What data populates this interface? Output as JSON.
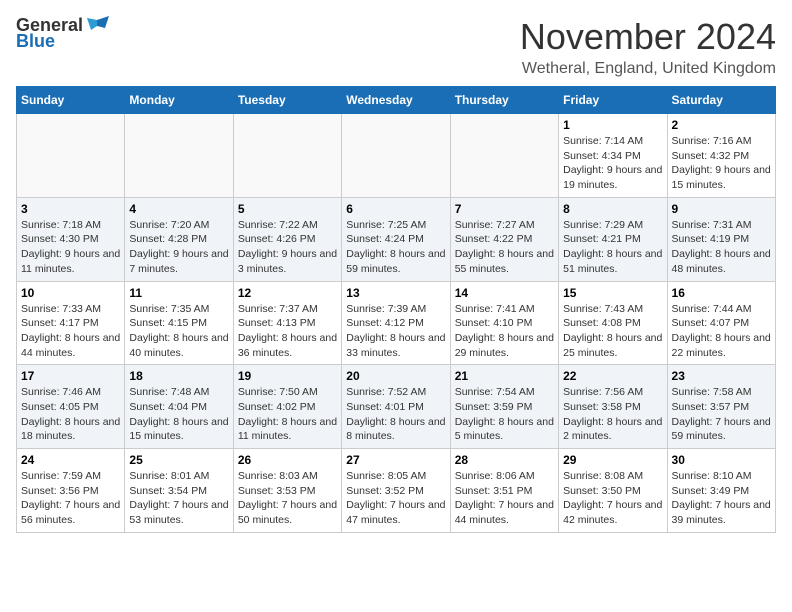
{
  "header": {
    "logo_general": "General",
    "logo_blue": "Blue",
    "month_title": "November 2024",
    "location": "Wetheral, England, United Kingdom"
  },
  "days_of_week": [
    "Sunday",
    "Monday",
    "Tuesday",
    "Wednesday",
    "Thursday",
    "Friday",
    "Saturday"
  ],
  "weeks": [
    [
      {
        "day": "",
        "info": ""
      },
      {
        "day": "",
        "info": ""
      },
      {
        "day": "",
        "info": ""
      },
      {
        "day": "",
        "info": ""
      },
      {
        "day": "",
        "info": ""
      },
      {
        "day": "1",
        "info": "Sunrise: 7:14 AM\nSunset: 4:34 PM\nDaylight: 9 hours and 19 minutes."
      },
      {
        "day": "2",
        "info": "Sunrise: 7:16 AM\nSunset: 4:32 PM\nDaylight: 9 hours and 15 minutes."
      }
    ],
    [
      {
        "day": "3",
        "info": "Sunrise: 7:18 AM\nSunset: 4:30 PM\nDaylight: 9 hours and 11 minutes."
      },
      {
        "day": "4",
        "info": "Sunrise: 7:20 AM\nSunset: 4:28 PM\nDaylight: 9 hours and 7 minutes."
      },
      {
        "day": "5",
        "info": "Sunrise: 7:22 AM\nSunset: 4:26 PM\nDaylight: 9 hours and 3 minutes."
      },
      {
        "day": "6",
        "info": "Sunrise: 7:25 AM\nSunset: 4:24 PM\nDaylight: 8 hours and 59 minutes."
      },
      {
        "day": "7",
        "info": "Sunrise: 7:27 AM\nSunset: 4:22 PM\nDaylight: 8 hours and 55 minutes."
      },
      {
        "day": "8",
        "info": "Sunrise: 7:29 AM\nSunset: 4:21 PM\nDaylight: 8 hours and 51 minutes."
      },
      {
        "day": "9",
        "info": "Sunrise: 7:31 AM\nSunset: 4:19 PM\nDaylight: 8 hours and 48 minutes."
      }
    ],
    [
      {
        "day": "10",
        "info": "Sunrise: 7:33 AM\nSunset: 4:17 PM\nDaylight: 8 hours and 44 minutes."
      },
      {
        "day": "11",
        "info": "Sunrise: 7:35 AM\nSunset: 4:15 PM\nDaylight: 8 hours and 40 minutes."
      },
      {
        "day": "12",
        "info": "Sunrise: 7:37 AM\nSunset: 4:13 PM\nDaylight: 8 hours and 36 minutes."
      },
      {
        "day": "13",
        "info": "Sunrise: 7:39 AM\nSunset: 4:12 PM\nDaylight: 8 hours and 33 minutes."
      },
      {
        "day": "14",
        "info": "Sunrise: 7:41 AM\nSunset: 4:10 PM\nDaylight: 8 hours and 29 minutes."
      },
      {
        "day": "15",
        "info": "Sunrise: 7:43 AM\nSunset: 4:08 PM\nDaylight: 8 hours and 25 minutes."
      },
      {
        "day": "16",
        "info": "Sunrise: 7:44 AM\nSunset: 4:07 PM\nDaylight: 8 hours and 22 minutes."
      }
    ],
    [
      {
        "day": "17",
        "info": "Sunrise: 7:46 AM\nSunset: 4:05 PM\nDaylight: 8 hours and 18 minutes."
      },
      {
        "day": "18",
        "info": "Sunrise: 7:48 AM\nSunset: 4:04 PM\nDaylight: 8 hours and 15 minutes."
      },
      {
        "day": "19",
        "info": "Sunrise: 7:50 AM\nSunset: 4:02 PM\nDaylight: 8 hours and 11 minutes."
      },
      {
        "day": "20",
        "info": "Sunrise: 7:52 AM\nSunset: 4:01 PM\nDaylight: 8 hours and 8 minutes."
      },
      {
        "day": "21",
        "info": "Sunrise: 7:54 AM\nSunset: 3:59 PM\nDaylight: 8 hours and 5 minutes."
      },
      {
        "day": "22",
        "info": "Sunrise: 7:56 AM\nSunset: 3:58 PM\nDaylight: 8 hours and 2 minutes."
      },
      {
        "day": "23",
        "info": "Sunrise: 7:58 AM\nSunset: 3:57 PM\nDaylight: 7 hours and 59 minutes."
      }
    ],
    [
      {
        "day": "24",
        "info": "Sunrise: 7:59 AM\nSunset: 3:56 PM\nDaylight: 7 hours and 56 minutes."
      },
      {
        "day": "25",
        "info": "Sunrise: 8:01 AM\nSunset: 3:54 PM\nDaylight: 7 hours and 53 minutes."
      },
      {
        "day": "26",
        "info": "Sunrise: 8:03 AM\nSunset: 3:53 PM\nDaylight: 7 hours and 50 minutes."
      },
      {
        "day": "27",
        "info": "Sunrise: 8:05 AM\nSunset: 3:52 PM\nDaylight: 7 hours and 47 minutes."
      },
      {
        "day": "28",
        "info": "Sunrise: 8:06 AM\nSunset: 3:51 PM\nDaylight: 7 hours and 44 minutes."
      },
      {
        "day": "29",
        "info": "Sunrise: 8:08 AM\nSunset: 3:50 PM\nDaylight: 7 hours and 42 minutes."
      },
      {
        "day": "30",
        "info": "Sunrise: 8:10 AM\nSunset: 3:49 PM\nDaylight: 7 hours and 39 minutes."
      }
    ]
  ]
}
